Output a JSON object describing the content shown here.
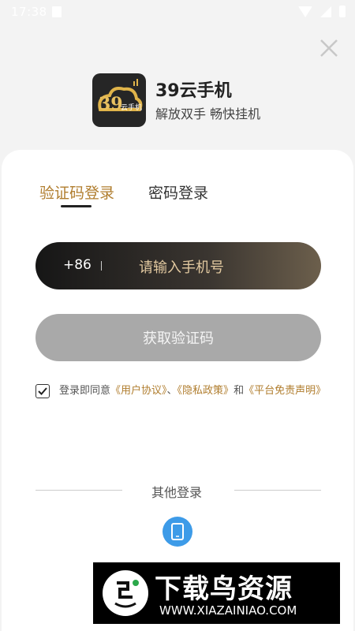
{
  "status_bar": {
    "time": "17:38"
  },
  "app": {
    "name": "39云手机",
    "slogan": "解放双手 畅快挂机",
    "logo_text_number": "39",
    "logo_text_label": "云手机",
    "accent_color": "#b07d2e"
  },
  "tabs": [
    {
      "label": "验证码登录",
      "active": true
    },
    {
      "label": "密码登录",
      "active": false
    }
  ],
  "phone_input": {
    "country_code": "+86",
    "placeholder": "请输入手机号"
  },
  "get_code_button": {
    "label": "获取验证码"
  },
  "agreement": {
    "checked": true,
    "prefix": "登录即同意",
    "user_agreement": "《用户协议》",
    "separator": "、",
    "privacy_policy": "《隐私政策》",
    "conjunction": "和",
    "disclaimer": "《平台免责声明》"
  },
  "other_login": {
    "label": "其他登录",
    "method_icon": "phone-icon"
  },
  "watermark": {
    "title": "下载鸟资源",
    "url": "WWW.XIAZAINIAO.COM"
  }
}
